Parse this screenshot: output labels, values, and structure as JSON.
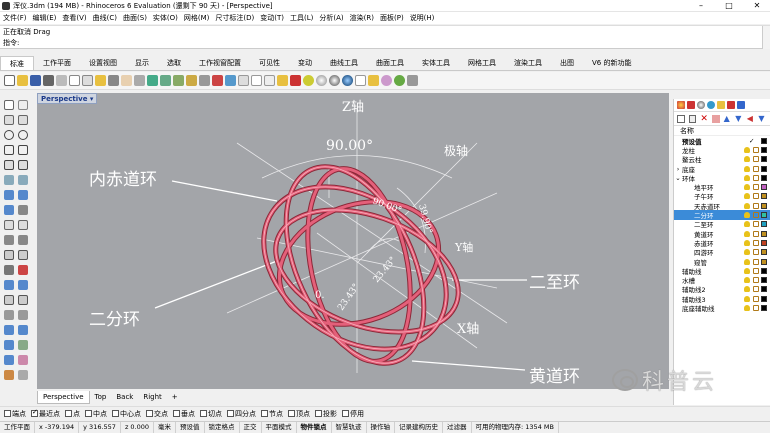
{
  "app": {
    "title": "浑仪.3dm (194 MB) - Rhinoceros 6 Evaluation (還剩下 90 天) - [Perspective]",
    "window_controls": [
      "–",
      "□",
      "✕"
    ]
  },
  "menu": [
    "文件(F)",
    "编辑(E)",
    "查看(V)",
    "曲线(C)",
    "曲面(S)",
    "实体(O)",
    "网格(M)",
    "尺寸标注(D)",
    "变动(T)",
    "工具(L)",
    "分析(A)",
    "渲染(R)",
    "面板(P)",
    "说明(H)"
  ],
  "command": {
    "history": "正在取消 Drag",
    "prompt": "指令:"
  },
  "tabs": [
    "标准",
    "工作平面",
    "设置视图",
    "显示",
    "选取",
    "工作视窗配置",
    "可见性",
    "变动",
    "曲线工具",
    "曲面工具",
    "实体工具",
    "网格工具",
    "渲染工具",
    "出图",
    "V6 的新功能"
  ],
  "viewport": {
    "title": "Perspective",
    "labels": {
      "z_axis": "Z轴",
      "pole": "极轴",
      "y_axis": "Y轴",
      "x_axis": "X轴",
      "angle_90": "90.00°",
      "angle_90b": "90.00°",
      "angle_399": "39.90°",
      "angle_23a": "23.43°",
      "angle_23b": "23.43°",
      "angle_0": "0.",
      "inner_equator": "内赤道环",
      "two_equinox": "二分环",
      "two_solstice": "二至环",
      "ecliptic": "黄道环"
    }
  },
  "viewport_tabs": [
    "Perspective",
    "Top",
    "Back",
    "Right",
    "+"
  ],
  "osnap": [
    {
      "label": "端点",
      "checked": false
    },
    {
      "label": "最近点",
      "checked": true
    },
    {
      "label": "点",
      "checked": false
    },
    {
      "label": "中点",
      "checked": false
    },
    {
      "label": "中心点",
      "checked": false
    },
    {
      "label": "交点",
      "checked": false
    },
    {
      "label": "垂点",
      "checked": false
    },
    {
      "label": "切点",
      "checked": false
    },
    {
      "label": "四分点",
      "checked": false
    },
    {
      "label": "节点",
      "checked": false
    },
    {
      "label": "顶点",
      "checked": false
    },
    {
      "label": "投影",
      "checked": false
    },
    {
      "label": "停用",
      "checked": false
    }
  ],
  "status": [
    "工作平面",
    "x -379.194",
    "y 316.557",
    "z 0.000",
    "毫米",
    "预设值",
    "锁定格点",
    "正交",
    "平面模式",
    "物件锁点",
    "智慧轨迹",
    "操作轴",
    "记录建构历史",
    "过滤器",
    "可用的物理内存: 1354 MB"
  ],
  "layers": {
    "header": "名称",
    "items": [
      {
        "name": "预设值",
        "bold": true,
        "check": "✓",
        "color": "#000000"
      },
      {
        "name": "龙柱",
        "color": "#000000"
      },
      {
        "name": "鳌云柱",
        "color": "#000000"
      },
      {
        "name": "底座",
        "color": "#000000",
        "expand": "›"
      },
      {
        "name": "环体",
        "color": "#000000",
        "expand": "⌄"
      },
      {
        "name": "地平环",
        "indent": true,
        "color": "#c060c0"
      },
      {
        "name": "子午环",
        "indent": true,
        "color": "#c09020"
      },
      {
        "name": "天赤道环",
        "indent": true,
        "color": "#c09020"
      },
      {
        "name": "二分环",
        "indent": true,
        "color": "#30c0a0",
        "selected": true
      },
      {
        "name": "二至环",
        "indent": true,
        "color": "#20a0c0"
      },
      {
        "name": "黄道环",
        "indent": true,
        "color": "#c09020"
      },
      {
        "name": "赤道环",
        "indent": true,
        "color": "#c04020"
      },
      {
        "name": "四游环",
        "indent": true,
        "color": "#c09020"
      },
      {
        "name": "窥管",
        "indent": true,
        "color": "#c09020"
      },
      {
        "name": "辅助线",
        "color": "#000000"
      },
      {
        "name": "水槽",
        "color": "#000000"
      },
      {
        "name": "辅助线2",
        "color": "#000000"
      },
      {
        "name": "辅助线3",
        "color": "#000000"
      },
      {
        "name": "底座辅助线",
        "color": "#000000"
      }
    ]
  },
  "watermark": "科普云",
  "colors": {
    "ring": "#e4607a",
    "ring_dark": "#8c2838",
    "viewport_bg": "#a3a5a9",
    "selected": "#3b8bd8"
  }
}
